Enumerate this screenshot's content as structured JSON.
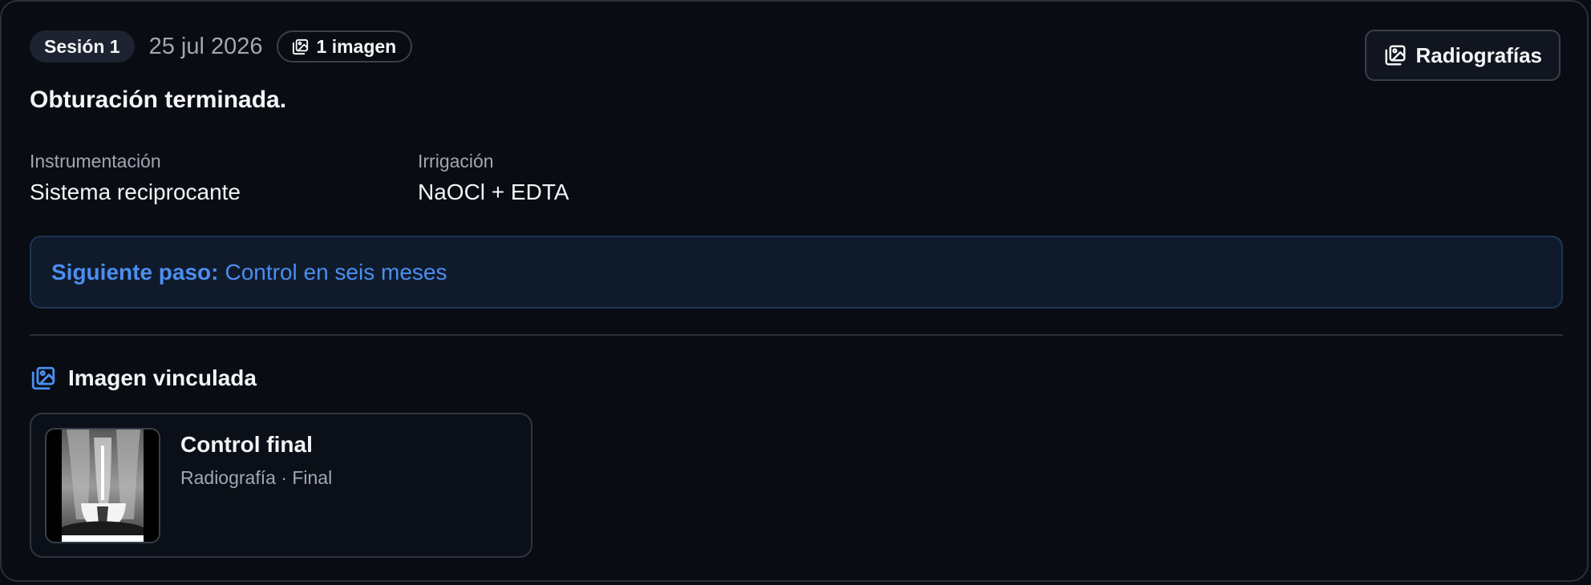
{
  "session": {
    "label": "Sesión 1",
    "date": "25 jul 2026",
    "images_badge": "1 imagen"
  },
  "actions": {
    "radiographs_button": "Radiografías"
  },
  "title": "Obturación terminada.",
  "fields": [
    {
      "label": "Instrumentación",
      "value": "Sistema reciprocante"
    },
    {
      "label": "Irrigación",
      "value": "NaOCl + EDTA"
    }
  ],
  "next_step": {
    "label": "Siguiente paso:",
    "value": "Control en seis meses"
  },
  "linked": {
    "heading": "Imagen vinculada",
    "image": {
      "title": "Control final",
      "subtitle": "Radiografía · Final"
    }
  },
  "colors": {
    "accent": "#4b8ef0",
    "background": "#090c12",
    "muted": "#a1a7b3"
  },
  "icons": {
    "images": "images-icon",
    "linked": "linked-image-icon"
  }
}
